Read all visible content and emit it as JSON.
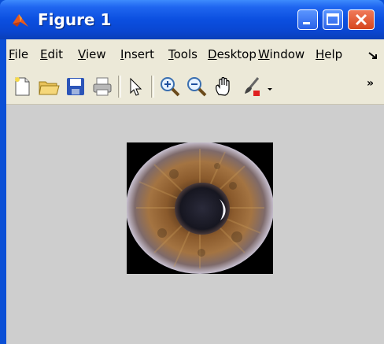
{
  "window": {
    "title": "Figure 1"
  },
  "window_controls": {
    "minimize": "minimize",
    "maximize": "maximize",
    "close": "close"
  },
  "menu": {
    "items": [
      {
        "first": "F",
        "rest": "ile"
      },
      {
        "first": "E",
        "rest": "dit"
      },
      {
        "first": "V",
        "rest": "iew"
      },
      {
        "first": "I",
        "rest": "nsert"
      },
      {
        "first": "T",
        "rest": "ools"
      },
      {
        "first": "D",
        "rest": "esktop"
      },
      {
        "first": "W",
        "rest": "indow"
      },
      {
        "first": "H",
        "rest": "elp"
      }
    ],
    "overflow_icon": "dock-arrow-icon"
  },
  "toolbar": {
    "icons": [
      "new-figure-icon",
      "open-file-icon",
      "save-icon",
      "print-icon",
      "pointer-arrow-icon",
      "zoom-in-icon",
      "zoom-out-icon",
      "pan-hand-icon",
      "data-cursor-brush-icon",
      "dropdown-arrow-icon"
    ],
    "overflow": "»"
  },
  "figure": {
    "image": "eye-iris-photo"
  }
}
